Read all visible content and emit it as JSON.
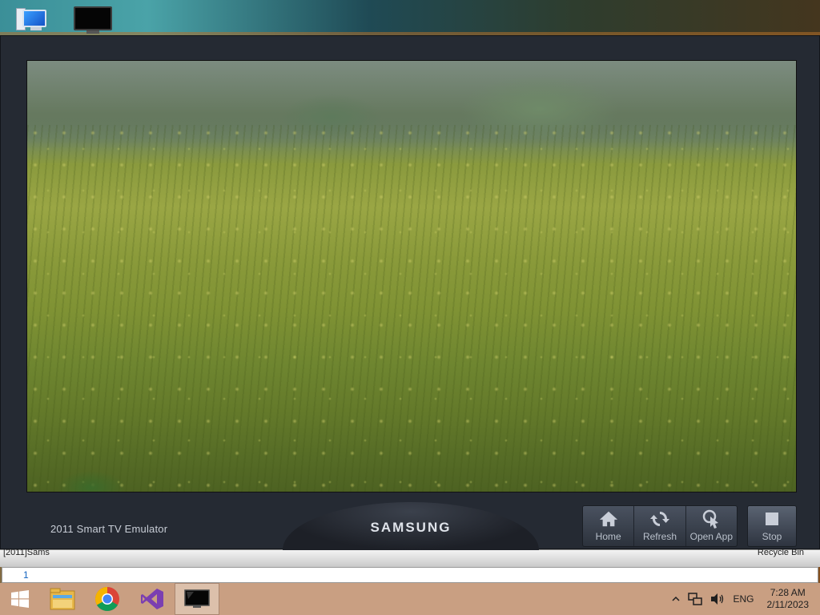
{
  "desktop": {
    "icons": [
      {
        "name": "this-pc",
        "icon": "computer-icon"
      },
      {
        "name": "smart-tv-emulator",
        "icon": "tv-monitor-icon"
      }
    ]
  },
  "emulator": {
    "title": "2011 Smart TV Emulator",
    "brand": "SAMSUNG",
    "screen_content": "meadow-of-yellow-flowers-photo",
    "controls": [
      {
        "label": "Home",
        "icon": "home-icon"
      },
      {
        "label": "Refresh",
        "icon": "refresh-icon"
      },
      {
        "label": "Open App",
        "icon": "open-app-icon"
      }
    ],
    "stop": {
      "label": "Stop",
      "icon": "stop-icon"
    }
  },
  "strip": {
    "left_text": "[2011]Sams",
    "right_text": "Recycle Bin"
  },
  "input_bar": {
    "value": "1"
  },
  "taskbar": {
    "apps": [
      {
        "name": "start",
        "icon": "windows-start-icon"
      },
      {
        "name": "file-explorer",
        "icon": "folder-icon"
      },
      {
        "name": "chrome",
        "icon": "chrome-icon"
      },
      {
        "name": "visual-studio",
        "icon": "visual-studio-icon"
      },
      {
        "name": "tv-emulator",
        "icon": "tv-monitor-icon",
        "active": true
      }
    ],
    "tray": {
      "language": "ENG",
      "time": "7:28 AM",
      "date": "2/11/2023"
    }
  },
  "colors": {
    "taskbar": "#c99f82",
    "emulator_frame": "#252a33",
    "input_text": "#1565c0"
  }
}
